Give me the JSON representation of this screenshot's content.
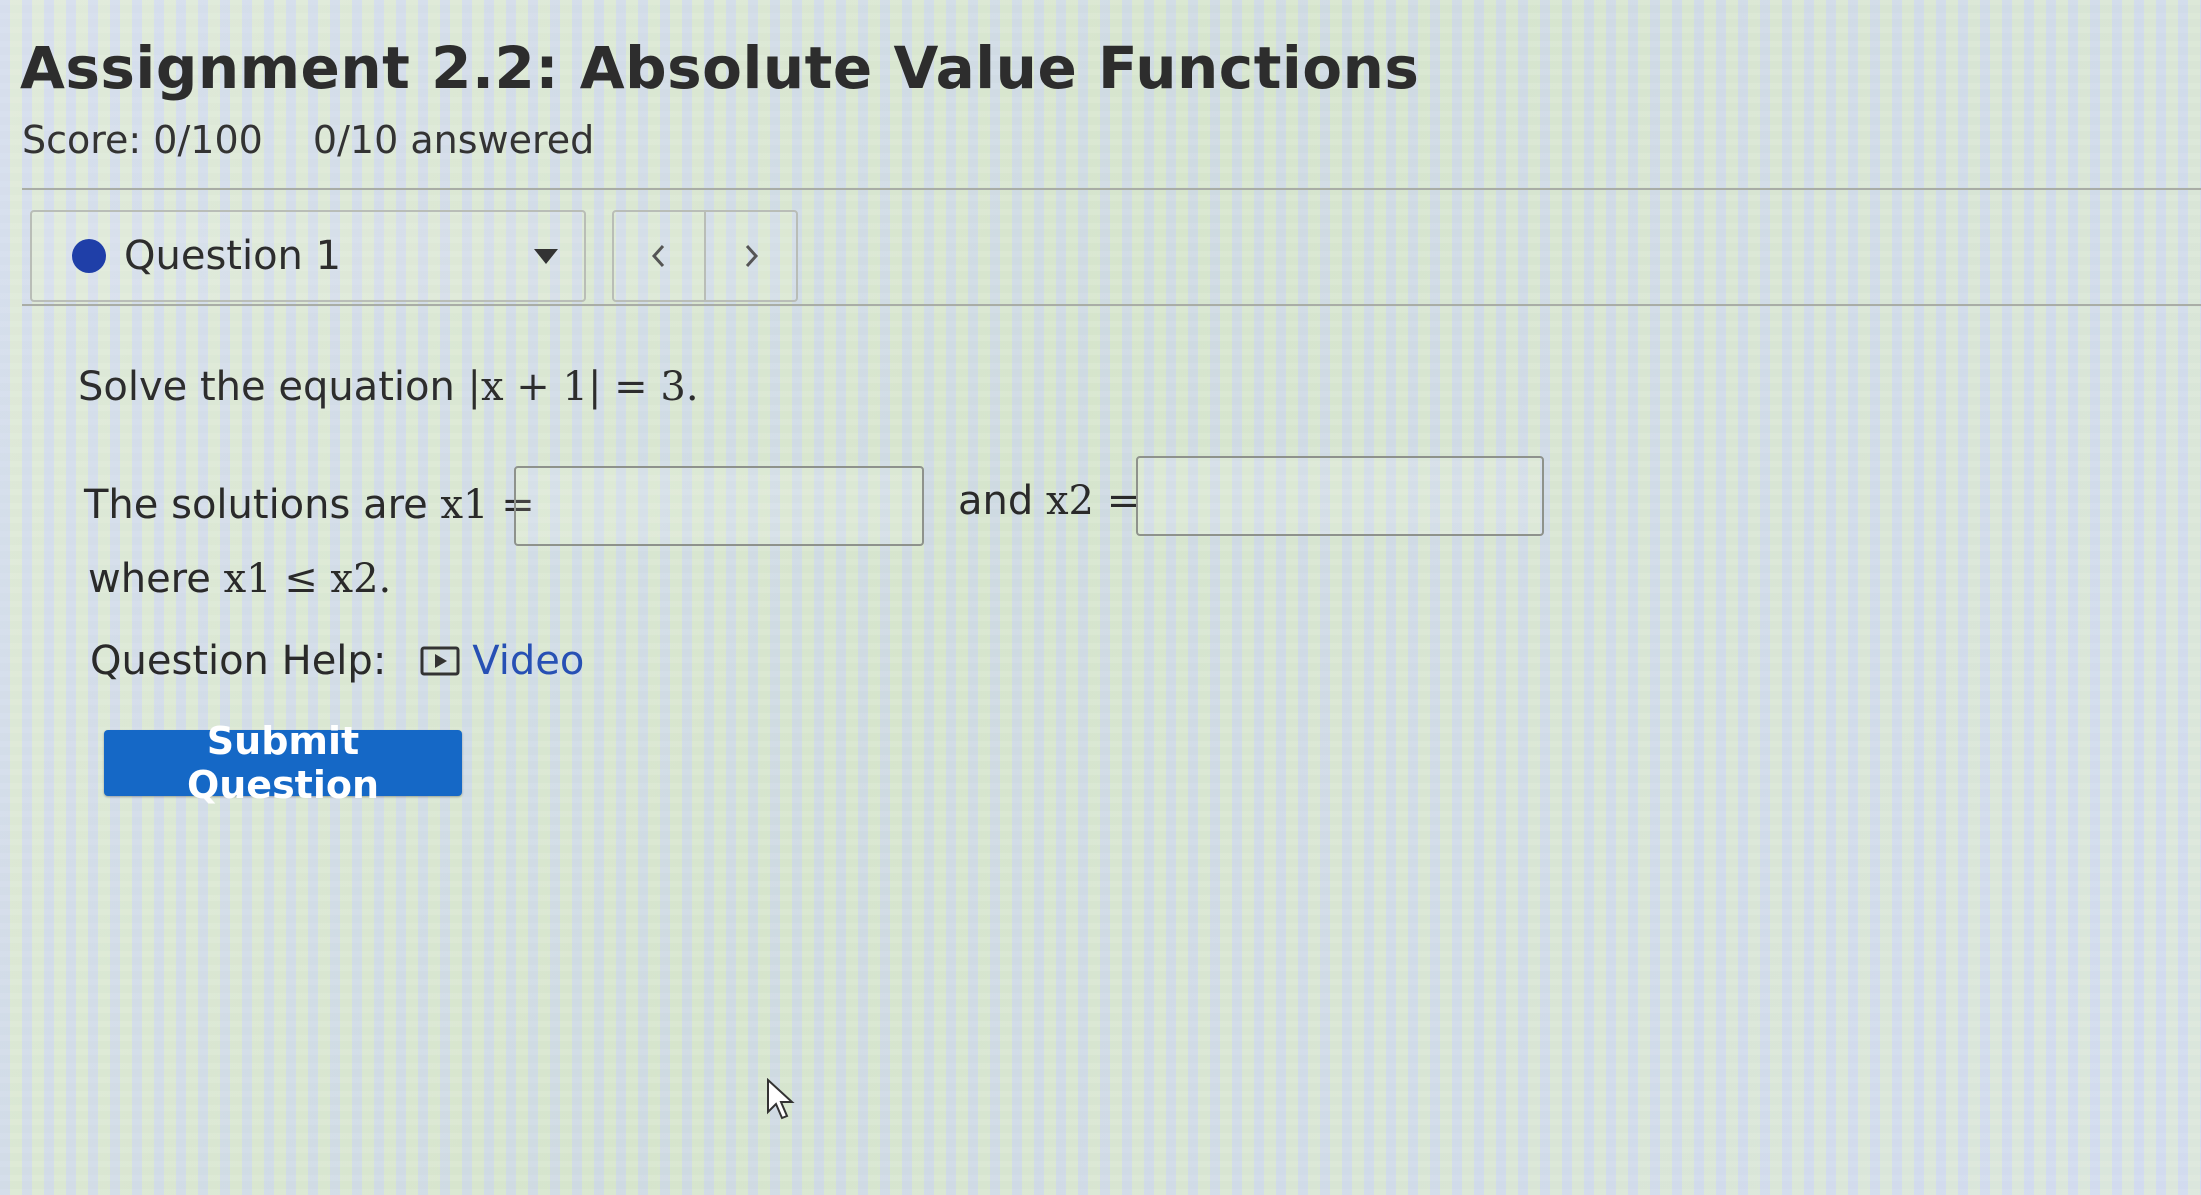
{
  "assignment": {
    "title": "Assignment 2.2: Absolute Value Functions",
    "score": "Score: 0/100",
    "answered": "0/10 answered"
  },
  "question_nav": {
    "selected": "Question 1",
    "status_color": "#1f3fa8",
    "prev_icon": "chevron-left-icon",
    "next_icon": "chevron-right-icon"
  },
  "question": {
    "prompt_text": "Solve the equation",
    "equation": "|x + 1| = 3.",
    "solutions_text": "The solutions are",
    "x1_label": "x1 =",
    "and_text": "and",
    "x2_label": "x2 =",
    "x1_value": "",
    "x2_value": "",
    "where_text": "where",
    "constraint": "x1 ≤ x2."
  },
  "help": {
    "label": "Question Help:",
    "link_label": "Video",
    "icon": "video-icon"
  },
  "actions": {
    "submit_label": "Submit Question",
    "submit_color": "#1568c6"
  }
}
